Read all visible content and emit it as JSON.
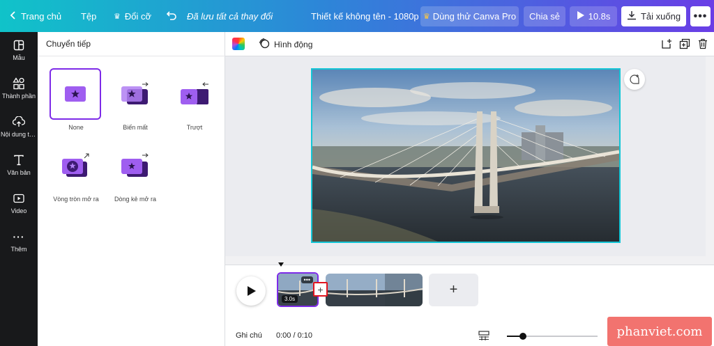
{
  "topbar": {
    "home": "Trang chủ",
    "file": "Tệp",
    "resize": "Đổi cỡ",
    "saved_status": "Đã lưu tất cả thay đổi",
    "doc_title": "Thiết kế không tên - 1080p",
    "try_pro": "Dùng thử Canva Pro",
    "share": "Chia sẻ",
    "duration": "10.8s",
    "download": "Tải xuống",
    "more": "•••"
  },
  "rail": {
    "items": [
      {
        "label": "Mẫu",
        "icon": "template-icon"
      },
      {
        "label": "Thành phần",
        "icon": "elements-icon"
      },
      {
        "label": "Nội dung tải lên",
        "icon": "upload-icon"
      },
      {
        "label": "Văn bản",
        "icon": "text-icon"
      },
      {
        "label": "Video",
        "icon": "video-icon"
      },
      {
        "label": "Thêm",
        "icon": "more-icon"
      }
    ]
  },
  "panel": {
    "title": "Chuyển tiếp",
    "transitions": [
      {
        "label": "None",
        "selected": true
      },
      {
        "label": "Biến mất",
        "selected": false
      },
      {
        "label": "Trượt",
        "selected": false
      },
      {
        "label": "Vòng tròn mở ra",
        "selected": false
      },
      {
        "label": "Dòng kẻ mở ra",
        "selected": false
      }
    ]
  },
  "toolbar": {
    "animation": "Hình động"
  },
  "timeline": {
    "clip1_duration": "3.0s",
    "clip_more": "•••",
    "add_transition": "+",
    "add_scene": "+",
    "notes": "Ghi chú",
    "timecode": "0:00 / 0:10",
    "zoom_level": 0.15
  },
  "watermark": "phanviet.com",
  "colors": {
    "accent": "#7d2ae8",
    "selection": "#13c6d6",
    "highlight": "#e0141e"
  }
}
